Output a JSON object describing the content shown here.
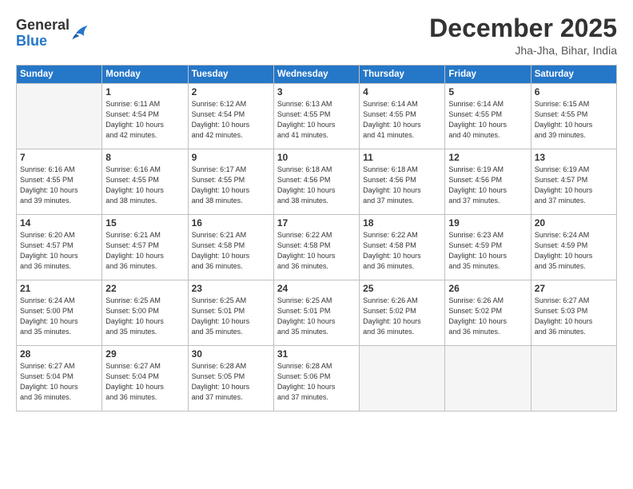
{
  "header": {
    "logo_general": "General",
    "logo_blue": "Blue",
    "month_title": "December 2025",
    "location": "Jha-Jha, Bihar, India"
  },
  "days_of_week": [
    "Sunday",
    "Monday",
    "Tuesday",
    "Wednesday",
    "Thursday",
    "Friday",
    "Saturday"
  ],
  "weeks": [
    [
      {
        "day": "",
        "info": ""
      },
      {
        "day": "1",
        "info": "Sunrise: 6:11 AM\nSunset: 4:54 PM\nDaylight: 10 hours\nand 42 minutes."
      },
      {
        "day": "2",
        "info": "Sunrise: 6:12 AM\nSunset: 4:54 PM\nDaylight: 10 hours\nand 42 minutes."
      },
      {
        "day": "3",
        "info": "Sunrise: 6:13 AM\nSunset: 4:55 PM\nDaylight: 10 hours\nand 41 minutes."
      },
      {
        "day": "4",
        "info": "Sunrise: 6:14 AM\nSunset: 4:55 PM\nDaylight: 10 hours\nand 41 minutes."
      },
      {
        "day": "5",
        "info": "Sunrise: 6:14 AM\nSunset: 4:55 PM\nDaylight: 10 hours\nand 40 minutes."
      },
      {
        "day": "6",
        "info": "Sunrise: 6:15 AM\nSunset: 4:55 PM\nDaylight: 10 hours\nand 39 minutes."
      }
    ],
    [
      {
        "day": "7",
        "info": "Sunrise: 6:16 AM\nSunset: 4:55 PM\nDaylight: 10 hours\nand 39 minutes."
      },
      {
        "day": "8",
        "info": "Sunrise: 6:16 AM\nSunset: 4:55 PM\nDaylight: 10 hours\nand 38 minutes."
      },
      {
        "day": "9",
        "info": "Sunrise: 6:17 AM\nSunset: 4:55 PM\nDaylight: 10 hours\nand 38 minutes."
      },
      {
        "day": "10",
        "info": "Sunrise: 6:18 AM\nSunset: 4:56 PM\nDaylight: 10 hours\nand 38 minutes."
      },
      {
        "day": "11",
        "info": "Sunrise: 6:18 AM\nSunset: 4:56 PM\nDaylight: 10 hours\nand 37 minutes."
      },
      {
        "day": "12",
        "info": "Sunrise: 6:19 AM\nSunset: 4:56 PM\nDaylight: 10 hours\nand 37 minutes."
      },
      {
        "day": "13",
        "info": "Sunrise: 6:19 AM\nSunset: 4:57 PM\nDaylight: 10 hours\nand 37 minutes."
      }
    ],
    [
      {
        "day": "14",
        "info": "Sunrise: 6:20 AM\nSunset: 4:57 PM\nDaylight: 10 hours\nand 36 minutes."
      },
      {
        "day": "15",
        "info": "Sunrise: 6:21 AM\nSunset: 4:57 PM\nDaylight: 10 hours\nand 36 minutes."
      },
      {
        "day": "16",
        "info": "Sunrise: 6:21 AM\nSunset: 4:58 PM\nDaylight: 10 hours\nand 36 minutes."
      },
      {
        "day": "17",
        "info": "Sunrise: 6:22 AM\nSunset: 4:58 PM\nDaylight: 10 hours\nand 36 minutes."
      },
      {
        "day": "18",
        "info": "Sunrise: 6:22 AM\nSunset: 4:58 PM\nDaylight: 10 hours\nand 36 minutes."
      },
      {
        "day": "19",
        "info": "Sunrise: 6:23 AM\nSunset: 4:59 PM\nDaylight: 10 hours\nand 35 minutes."
      },
      {
        "day": "20",
        "info": "Sunrise: 6:24 AM\nSunset: 4:59 PM\nDaylight: 10 hours\nand 35 minutes."
      }
    ],
    [
      {
        "day": "21",
        "info": "Sunrise: 6:24 AM\nSunset: 5:00 PM\nDaylight: 10 hours\nand 35 minutes."
      },
      {
        "day": "22",
        "info": "Sunrise: 6:25 AM\nSunset: 5:00 PM\nDaylight: 10 hours\nand 35 minutes."
      },
      {
        "day": "23",
        "info": "Sunrise: 6:25 AM\nSunset: 5:01 PM\nDaylight: 10 hours\nand 35 minutes."
      },
      {
        "day": "24",
        "info": "Sunrise: 6:25 AM\nSunset: 5:01 PM\nDaylight: 10 hours\nand 35 minutes."
      },
      {
        "day": "25",
        "info": "Sunrise: 6:26 AM\nSunset: 5:02 PM\nDaylight: 10 hours\nand 36 minutes."
      },
      {
        "day": "26",
        "info": "Sunrise: 6:26 AM\nSunset: 5:02 PM\nDaylight: 10 hours\nand 36 minutes."
      },
      {
        "day": "27",
        "info": "Sunrise: 6:27 AM\nSunset: 5:03 PM\nDaylight: 10 hours\nand 36 minutes."
      }
    ],
    [
      {
        "day": "28",
        "info": "Sunrise: 6:27 AM\nSunset: 5:04 PM\nDaylight: 10 hours\nand 36 minutes."
      },
      {
        "day": "29",
        "info": "Sunrise: 6:27 AM\nSunset: 5:04 PM\nDaylight: 10 hours\nand 36 minutes."
      },
      {
        "day": "30",
        "info": "Sunrise: 6:28 AM\nSunset: 5:05 PM\nDaylight: 10 hours\nand 37 minutes."
      },
      {
        "day": "31",
        "info": "Sunrise: 6:28 AM\nSunset: 5:06 PM\nDaylight: 10 hours\nand 37 minutes."
      },
      {
        "day": "",
        "info": ""
      },
      {
        "day": "",
        "info": ""
      },
      {
        "day": "",
        "info": ""
      }
    ]
  ]
}
